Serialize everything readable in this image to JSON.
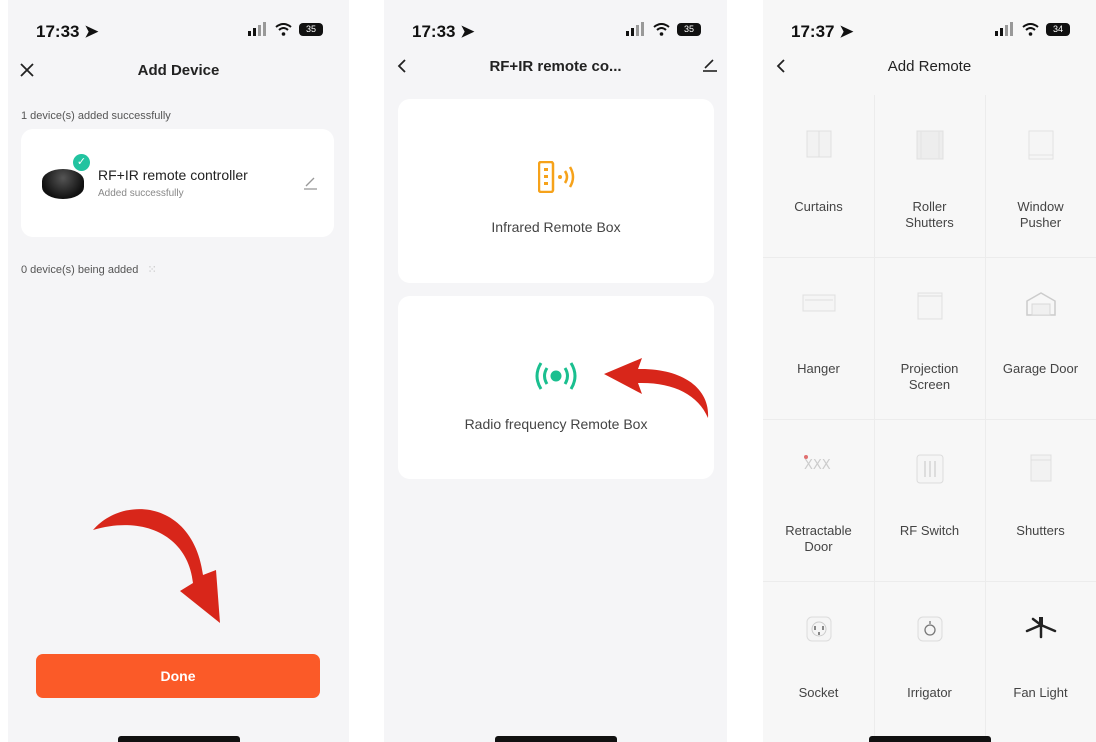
{
  "panel1": {
    "status_time": "17:33",
    "battery": "35",
    "title": "Add Device",
    "added_text": "1 device(s) added successfully",
    "device_name": "RF+IR remote controller",
    "device_status": "Added successfully",
    "adding_text": "0 device(s) being added",
    "done_label": "Done"
  },
  "panel2": {
    "status_time": "17:33",
    "battery": "35",
    "title": "RF+IR remote co...",
    "option1": "Infrared Remote Box",
    "option2": "Radio frequency Remote Box"
  },
  "panel3": {
    "status_time": "17:37",
    "battery": "34",
    "title": "Add Remote",
    "items": [
      {
        "label": "Curtains",
        "icon": "curtains-icon"
      },
      {
        "label": "Roller\nShutters",
        "icon": "roller-shutters-icon"
      },
      {
        "label": "Window\nPusher",
        "icon": "window-pusher-icon"
      },
      {
        "label": "Hanger",
        "icon": "hanger-icon"
      },
      {
        "label": "Projection\nScreen",
        "icon": "projection-screen-icon"
      },
      {
        "label": "Garage Door",
        "icon": "garage-door-icon"
      },
      {
        "label": "Retractable\nDoor",
        "icon": "retractable-door-icon"
      },
      {
        "label": "RF Switch",
        "icon": "rf-switch-icon"
      },
      {
        "label": "Shutters",
        "icon": "shutters-icon"
      },
      {
        "label": "Socket",
        "icon": "socket-icon"
      },
      {
        "label": "Irrigator",
        "icon": "irrigator-icon"
      },
      {
        "label": "Fan Light",
        "icon": "fan-light-icon"
      }
    ]
  },
  "colors": {
    "accent": "#fb5a28",
    "check": "#22c3a0",
    "ir": "#f6a21a",
    "rf": "#1abf8f",
    "arrow": "#d8261a"
  }
}
